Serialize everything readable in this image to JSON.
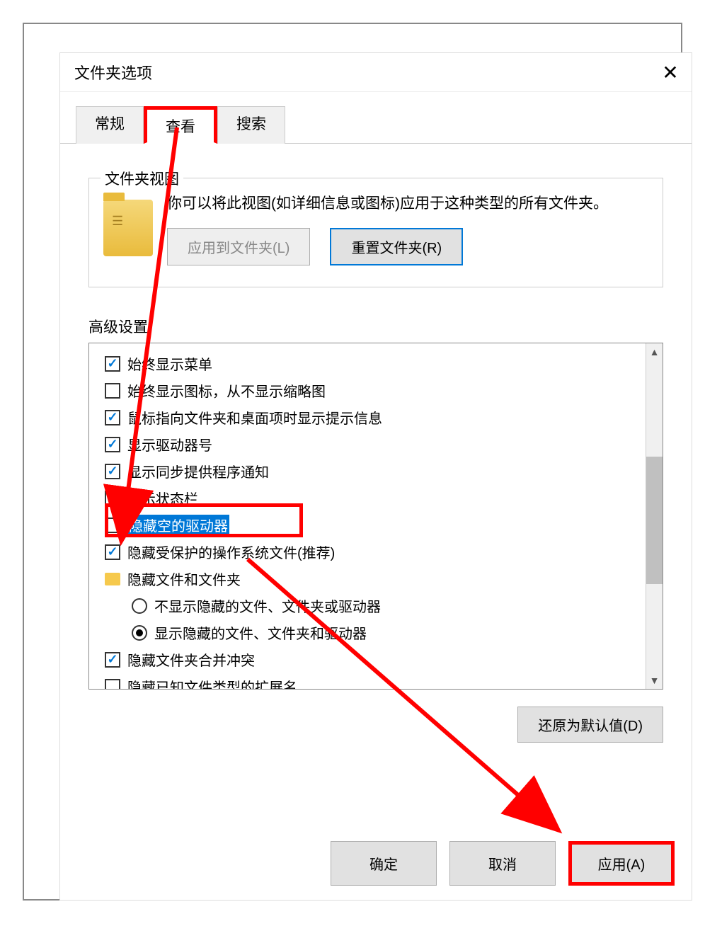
{
  "dialog": {
    "title": "文件夹选项"
  },
  "tabs": {
    "general": "常规",
    "view": "查看",
    "search": "搜索"
  },
  "groupbox": {
    "title": "文件夹视图",
    "description": "你可以将此视图(如详细信息或图标)应用于这种类型的所有文件夹。",
    "applyBtn": "应用到文件夹(L)",
    "resetBtn": "重置文件夹(R)"
  },
  "advanced": {
    "label": "高级设置:",
    "items": [
      {
        "type": "checkbox",
        "checked": true,
        "label": "始终显示菜单"
      },
      {
        "type": "checkbox",
        "checked": false,
        "label": "始终显示图标，从不显示缩略图"
      },
      {
        "type": "checkbox",
        "checked": true,
        "label": "鼠标指向文件夹和桌面项时显示提示信息"
      },
      {
        "type": "checkbox",
        "checked": true,
        "label": "显示驱动器号"
      },
      {
        "type": "checkbox",
        "checked": true,
        "label": "显示同步提供程序通知"
      },
      {
        "type": "checkbox",
        "checked": true,
        "label": "显示状态栏"
      },
      {
        "type": "checkbox",
        "checked": false,
        "label": "隐藏空的驱动器",
        "selected": true
      },
      {
        "type": "checkbox",
        "checked": true,
        "label": "隐藏受保护的操作系统文件(推荐)"
      },
      {
        "type": "folder",
        "label": "隐藏文件和文件夹"
      },
      {
        "type": "radio",
        "checked": false,
        "indent": 1,
        "label": "不显示隐藏的文件、文件夹或驱动器"
      },
      {
        "type": "radio",
        "checked": true,
        "indent": 1,
        "label": "显示隐藏的文件、文件夹和驱动器"
      },
      {
        "type": "checkbox",
        "checked": true,
        "label": "隐藏文件夹合并冲突"
      },
      {
        "type": "checkbox",
        "checked": false,
        "label": "隐藏已知文件类型的扩展名"
      }
    ]
  },
  "restoreBtn": "还原为默认值(D)",
  "buttons": {
    "ok": "确定",
    "cancel": "取消",
    "apply": "应用(A)"
  }
}
